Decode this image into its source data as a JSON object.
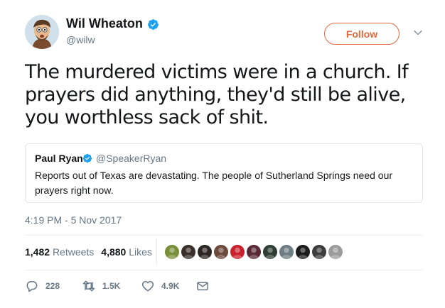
{
  "author": {
    "name": "Wil Wheaton",
    "handle": "@wilw"
  },
  "follow_label": "Follow",
  "tweet_text": "The murdered victims were in a church. If prayers did anything, they'd still be alive, you worthless sack of shit.",
  "quoted": {
    "name": "Paul Ryan",
    "handle": "@SpeakerRyan",
    "text": "Reports out of Texas are devastating. The people of Sutherland Springs need our prayers right now."
  },
  "timestamp": "4:19 PM - 5 Nov 2017",
  "stats": {
    "retweets_count": "1,482",
    "retweets_label": "Retweets",
    "likes_count": "4,880",
    "likes_label": "Likes"
  },
  "likers": [
    {
      "color": "#7a8f3a"
    },
    {
      "color": "#3a2e2a"
    },
    {
      "color": "#2b2623"
    },
    {
      "color": "#6b4a3a"
    },
    {
      "color": "#c8202c"
    },
    {
      "color": "#5a2b36"
    },
    {
      "color": "#2f3f35"
    },
    {
      "color": "#6e7c83"
    },
    {
      "color": "#1c1c1c"
    },
    {
      "color": "#3d3d3d"
    },
    {
      "color": "#9b9b9b"
    }
  ],
  "actions": {
    "reply_count": "228",
    "retweet_count": "1.5K",
    "like_count": "4.9K"
  },
  "colors": {
    "verified": "#1da1f2",
    "follow": "#e2683c",
    "secondary_text": "#657786"
  }
}
